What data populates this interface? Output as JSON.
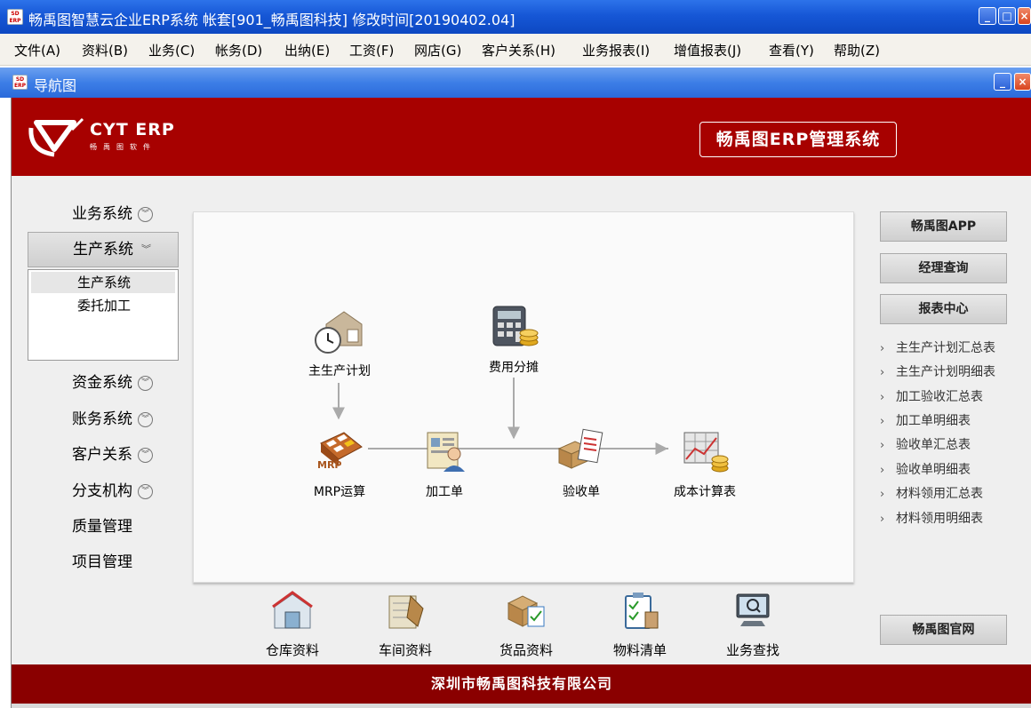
{
  "window": {
    "title": "畅禹图智慧云企业ERP系统  帐套[901_畅禹图科技] 修改时间[20190402.04]",
    "app_icon_text": "SD ERP"
  },
  "menu": [
    {
      "label": "文件(A)"
    },
    {
      "label": "资料(B)"
    },
    {
      "label": "业务(C)"
    },
    {
      "label": "帐务(D)"
    },
    {
      "label": "出纳(E)"
    },
    {
      "label": "工资(F)"
    },
    {
      "label": "网店(G)"
    },
    {
      "label": "客户关系(H)"
    },
    {
      "label": "业务报表(I)"
    },
    {
      "label": "增值报表(J)"
    },
    {
      "label": "查看(Y)"
    },
    {
      "label": "帮助(Z)"
    }
  ],
  "subwindow": {
    "title": "导航图",
    "icon_text": "SD ERP"
  },
  "header": {
    "logo_text": "CYT ERP",
    "logo_sub": "畅禹图软件",
    "system_title": "畅禹图ERP管理系统",
    "accent": "#a70100"
  },
  "nav": {
    "items": [
      {
        "label": "业务系统",
        "icon": "chevron-down-icon"
      },
      {
        "label": "生产系统",
        "icon": "chevron-double-down-icon",
        "active": true
      },
      {
        "label": "资金系统",
        "icon": "chevron-down-icon"
      },
      {
        "label": "账务系统",
        "icon": "chevron-down-icon"
      },
      {
        "label": "客户关系",
        "icon": "chevron-down-icon"
      },
      {
        "label": "分支机构",
        "icon": "chevron-down-icon"
      },
      {
        "label": "质量管理"
      },
      {
        "label": "项目管理"
      }
    ],
    "sub_items": [
      {
        "label": "生产系统",
        "selected": true
      },
      {
        "label": "委托加工"
      }
    ]
  },
  "flow": {
    "nodes": [
      {
        "label": "主生产计划",
        "icon": "factory-clock-icon"
      },
      {
        "label": "费用分摊",
        "icon": "calculator-coins-icon"
      },
      {
        "label": "MRP运算",
        "icon": "mrp-calculator-icon"
      },
      {
        "label": "加工单",
        "icon": "worker-document-icon"
      },
      {
        "label": "验收单",
        "icon": "box-checklist-icon"
      },
      {
        "label": "成本计算表",
        "icon": "cost-chart-coins-icon"
      }
    ]
  },
  "tools": [
    {
      "label": "仓库资料",
      "icon": "warehouse-icon"
    },
    {
      "label": "车间资料",
      "icon": "workshop-icon"
    },
    {
      "label": "货品资料",
      "icon": "goods-box-icon"
    },
    {
      "label": "物料清单",
      "icon": "clipboard-checklist-icon"
    },
    {
      "label": "业务查找",
      "icon": "computer-search-icon"
    }
  ],
  "right": {
    "buttons": [
      {
        "label": "畅禹图APP"
      },
      {
        "label": "经理查询"
      },
      {
        "label": "报表中心"
      }
    ],
    "reports": [
      {
        "label": "主生产计划汇总表"
      },
      {
        "label": "主生产计划明细表"
      },
      {
        "label": "加工验收汇总表"
      },
      {
        "label": "加工单明细表"
      },
      {
        "label": "验收单汇总表"
      },
      {
        "label": "验收单明细表"
      },
      {
        "label": "材料领用汇总表"
      },
      {
        "label": "材料领用明细表"
      }
    ],
    "website_button": "畅禹图官网"
  },
  "footer": {
    "company": "深圳市畅禹图科技有限公司"
  }
}
